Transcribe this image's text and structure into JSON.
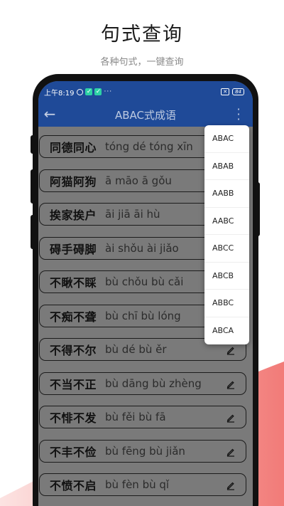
{
  "hero": {
    "title": "句式查询",
    "subtitle": "各种句式，一键查询"
  },
  "statusbar": {
    "time": "上午8:19",
    "icons": [
      "alarm-icon",
      "shield-icon",
      "shield-icon",
      "more-dots-icon"
    ],
    "sim_label": "✕",
    "battery": "84"
  },
  "toolbar": {
    "title": "ABAC式成语",
    "back_icon": "arrow-left-icon",
    "more_icon": "vertical-dots-icon"
  },
  "idioms": [
    {
      "idiom": "同德同心",
      "pinyin": "tóng dé tóng xīn"
    },
    {
      "idiom": "阿猫阿狗",
      "pinyin": "ā māo ā gǒu"
    },
    {
      "idiom": "挨家挨户",
      "pinyin": "āi jiā āi hù"
    },
    {
      "idiom": "碍手碍脚",
      "pinyin": "ài shǒu ài jiǎo"
    },
    {
      "idiom": "不瞅不睬",
      "pinyin": "bù chǒu bù cǎi"
    },
    {
      "idiom": "不痴不聋",
      "pinyin": "bù chī bù lóng"
    },
    {
      "idiom": "不得不尔",
      "pinyin": "bù dé bù ěr"
    },
    {
      "idiom": "不当不正",
      "pinyin": "bù dāng bù zhèng"
    },
    {
      "idiom": "不悱不发",
      "pinyin": "bù fěi bù fā"
    },
    {
      "idiom": "不丰不俭",
      "pinyin": "bù fēng bù jiǎn"
    },
    {
      "idiom": "不愤不启",
      "pinyin": "bù fèn bù qǐ"
    }
  ],
  "menu": {
    "items": [
      "ABAC",
      "ABAB",
      "AABB",
      "AABC",
      "ABCC",
      "ABCB",
      "ABBC",
      "ABCA"
    ]
  },
  "colors": {
    "app_bar": "#1f4a98",
    "accent_red": "#f27b78",
    "list_bg_dimmed": "#7a7a7a"
  }
}
